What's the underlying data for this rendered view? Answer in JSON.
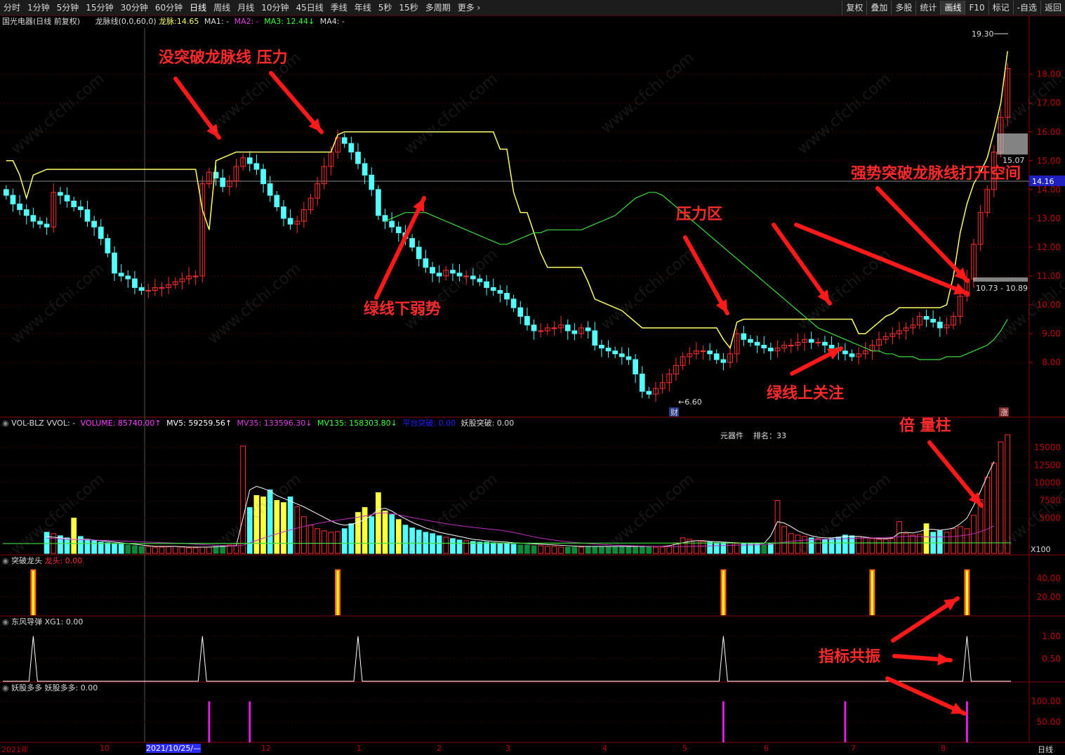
{
  "toolbar": {
    "periods": [
      "分时",
      "1分钟",
      "5分钟",
      "15分钟",
      "30分钟",
      "60分钟",
      "日线",
      "周线",
      "月线",
      "10分钟",
      "45日线",
      "季线",
      "年线",
      "5秒",
      "15秒",
      "多周期",
      "更多"
    ],
    "active_period": "日线",
    "right_buttons": [
      "复权",
      "叠加",
      "多股",
      "统计",
      "画线",
      "F10",
      "标记",
      "-自选",
      "返回"
    ],
    "active_right": "画线"
  },
  "main_panel": {
    "stock_name": "国光电器",
    "mode": "(日线 前复权)",
    "indicator": "龙脉线(0,0,60,0)",
    "longmai_label": "龙脉:",
    "longmai_value": "14.65",
    "ma1": "MA1: -",
    "ma2": "MA2: -",
    "ma3": "MA3: 12.44↓",
    "ma4": "MA4: -",
    "high_label": "19.30",
    "low_label": "6.60",
    "price_tag": "14.16",
    "box1_label": "15.07",
    "box2_label": "10.73 - 10.89",
    "cai_tag": "财",
    "zhang_tag": "涨"
  },
  "volume_panel": {
    "name": "VOL-BLZ",
    "vvol": "VVOL: -",
    "volume": "VOLUME: 85740.00↑",
    "mv5": "MV5: 59259.56↑",
    "mv35": "MV35: 133596.30↓",
    "mv135": "MV135: 158303.80↓",
    "platform": "平台突破: 0.00",
    "yaogu": "妖股突破: 0.00",
    "sector": "元器件",
    "rank": "排名：33",
    "x100": "X100"
  },
  "ind1": {
    "name": "突破龙头",
    "label": "龙头: 0.00"
  },
  "ind2": {
    "name": "东风导弹",
    "label": "XG1: 0.00"
  },
  "ind3": {
    "name": "妖股多多",
    "label": "妖股多多: 0.00"
  },
  "annotations": {
    "a1": "没突破龙脉线 压力",
    "a2": "绿线下弱势",
    "a3": "压力区",
    "a4": "强势突破龙脉线打开空间",
    "a5": "绿线上关注",
    "a6": "倍 量柱",
    "a7": "指标共振"
  },
  "watermark": "www.cfchi.com",
  "bottom_axis": {
    "labels": [
      "2021年",
      "10",
      "2021/10/25/—",
      "12",
      "1",
      "2",
      "3",
      "4",
      "5",
      "6",
      "7",
      "8"
    ],
    "period": "日线"
  },
  "chart_data": [
    {
      "type": "candlestick",
      "title": "国光电器 (日线 前复权)",
      "y_ticks": [
        8.0,
        9.0,
        10.0,
        11.0,
        12.0,
        13.0,
        14.0,
        15.0,
        16.0,
        17.0,
        18.0
      ],
      "ylim": [
        6.2,
        19.6
      ],
      "close": [
        13.8,
        13.5,
        13.3,
        13.1,
        12.9,
        12.8,
        12.7,
        13.9,
        13.8,
        13.6,
        13.4,
        13.3,
        12.9,
        12.7,
        12.3,
        11.8,
        11.1,
        11.0,
        10.9,
        10.6,
        10.5,
        10.5,
        10.6,
        10.6,
        10.7,
        10.8,
        10.9,
        11.0,
        11.0,
        14.2,
        14.6,
        14.4,
        14.1,
        14.3,
        14.8,
        15.1,
        14.9,
        14.7,
        14.2,
        13.8,
        13.4,
        13.0,
        12.8,
        12.9,
        13.3,
        13.7,
        14.2,
        14.8,
        15.3,
        15.8,
        15.6,
        15.3,
        14.9,
        14.5,
        14.0,
        13.1,
        12.9,
        12.7,
        12.5,
        12.3,
        12.0,
        11.6,
        11.3,
        11.1,
        11.0,
        11.2,
        11.1,
        11.0,
        11.0,
        10.9,
        10.8,
        10.6,
        10.5,
        10.4,
        10.2,
        9.9,
        9.6,
        9.3,
        9.1,
        9.1,
        9.2,
        9.2,
        9.3,
        9.1,
        9.0,
        9.2,
        9.1,
        8.6,
        8.5,
        8.4,
        8.3,
        8.2,
        8.1,
        7.6,
        7.0,
        6.9,
        7.1,
        7.3,
        7.6,
        7.9,
        8.2,
        8.3,
        8.4,
        8.4,
        8.3,
        8.1,
        8.0,
        8.3,
        9.0,
        8.8,
        8.7,
        8.6,
        8.5,
        8.4,
        8.5,
        8.6,
        8.6,
        8.7,
        8.8,
        8.7,
        8.7,
        8.6,
        8.5,
        8.4,
        8.3,
        8.2,
        8.3,
        8.4,
        8.6,
        8.8,
        8.9,
        9.0,
        9.1,
        9.2,
        9.3,
        9.6,
        9.5,
        9.4,
        9.2,
        9.3,
        9.6,
        10.3,
        10.9,
        12.1,
        13.2,
        14.0,
        15.3,
        16.5,
        18.2
      ],
      "dragon_line": [
        15.0,
        15.0,
        14.5,
        13.7,
        14.5,
        14.6,
        14.7,
        14.7,
        14.7,
        14.7,
        14.7,
        14.7,
        14.7,
        14.7,
        14.7,
        14.7,
        14.7,
        14.7,
        14.7,
        14.7,
        14.7,
        14.7,
        14.7,
        14.7,
        14.7,
        14.7,
        14.7,
        14.7,
        14.7,
        13.3,
        12.6,
        15.0,
        15.1,
        15.2,
        15.3,
        15.3,
        15.3,
        15.3,
        15.3,
        15.3,
        15.3,
        15.3,
        15.3,
        15.3,
        15.3,
        15.3,
        15.3,
        15.3,
        15.3,
        15.9,
        16.0,
        16.0,
        16.0,
        16.0,
        16.0,
        16.0,
        16.0,
        16.0,
        16.0,
        16.0,
        16.0,
        16.0,
        16.0,
        16.0,
        16.0,
        16.0,
        16.0,
        16.0,
        16.0,
        16.0,
        16.0,
        16.0,
        16.0,
        15.4,
        15.4,
        13.9,
        13.2,
        13.2,
        12.5,
        11.8,
        11.3,
        11.3,
        11.3,
        11.3,
        11.3,
        11.3,
        10.8,
        10.2,
        10.1,
        10.0,
        9.9,
        9.8,
        9.6,
        9.4,
        9.2,
        9.2,
        9.2,
        9.2,
        9.2,
        9.2,
        9.2,
        9.2,
        9.2,
        9.2,
        9.2,
        9.2,
        8.8,
        8.5,
        9.4,
        9.5,
        9.5,
        9.5,
        9.5,
        9.5,
        9.5,
        9.5,
        9.5,
        9.5,
        9.5,
        9.5,
        9.5,
        9.5,
        9.5,
        9.5,
        9.5,
        9.5,
        9.0,
        9.0,
        9.2,
        9.4,
        9.6,
        9.7,
        9.9,
        9.9,
        9.9,
        9.9,
        9.9,
        9.9,
        9.9,
        10.0,
        11.0,
        12.5,
        13.5,
        14.2,
        14.6,
        15.1,
        16.0,
        17.0,
        18.8
      ],
      "ma3_green": [
        12.9,
        13.0,
        13.1,
        13.2,
        13.2,
        13.2,
        13.2,
        13.1,
        13.0,
        12.9,
        12.8,
        12.7,
        12.6,
        12.5,
        12.4,
        12.3,
        12.2,
        12.1,
        12.1,
        12.2,
        12.3,
        12.4,
        12.5,
        12.5,
        12.6,
        12.6,
        12.6,
        12.6,
        12.6,
        12.6,
        12.7,
        12.8,
        12.9,
        13.0,
        13.1,
        13.3,
        13.5,
        13.7,
        13.8,
        13.9,
        13.9,
        13.8,
        13.6,
        13.4,
        13.2,
        13.0,
        12.8,
        12.6,
        12.4,
        12.2,
        12.0,
        11.8,
        11.6,
        11.4,
        11.2,
        11.0,
        10.8,
        10.6,
        10.4,
        10.2,
        10.0,
        9.8,
        9.6,
        9.4,
        9.2,
        9.1,
        9.0,
        8.9,
        8.8,
        8.7,
        8.6,
        8.5,
        8.4,
        8.4,
        8.3,
        8.3,
        8.2,
        8.2,
        8.2,
        8.1,
        8.1,
        8.1,
        8.1,
        8.2,
        8.2,
        8.2,
        8.3,
        8.4,
        8.5,
        8.6,
        8.8,
        9.1,
        9.5
      ],
      "annotations": [
        "没突破龙脉线 压力",
        "绿线下弱势",
        "压力区",
        "强势突破龙脉线打开空间",
        "绿线上关注"
      ],
      "max_label": "19.30",
      "min_label": "6.60"
    },
    {
      "type": "bar",
      "title": "VOL-BLZ",
      "y_ticks": [
        5000,
        7500,
        10000,
        12500,
        15000
      ],
      "ylim": [
        0,
        17500
      ],
      "unit": "X100",
      "volume": [
        3000,
        2800,
        2500,
        2200,
        5000,
        2400,
        2000,
        1800,
        1600,
        1500,
        1400,
        1300,
        1200,
        1100,
        1000,
        1000,
        900,
        900,
        950,
        1000,
        900,
        800,
        800,
        900,
        900,
        1000,
        1100,
        1200,
        1400,
        15200,
        6500,
        8200,
        8000,
        9000,
        7500,
        7200,
        8000,
        6600,
        5200,
        4000,
        3500,
        3200,
        3000,
        3100,
        3500,
        4200,
        5800,
        6500,
        5200,
        8600,
        6000,
        5500,
        4800,
        4000,
        3600,
        3300,
        3000,
        2800,
        2500,
        2300,
        2100,
        1900,
        1800,
        1700,
        1600,
        1600,
        1500,
        1400,
        1400,
        1300,
        1200,
        1200,
        1100,
        1100,
        1000,
        1000,
        900,
        900,
        900,
        900,
        900,
        900,
        900,
        900,
        1000,
        1000,
        1000,
        900,
        900,
        900,
        900,
        900,
        1000,
        1500,
        2200,
        2000,
        1800,
        1700,
        1600,
        1500,
        1500,
        1500,
        1400,
        1400,
        1300,
        1300,
        1200,
        1400,
        7500,
        3800,
        2800,
        2600,
        2400,
        2200,
        2100,
        2000,
        2100,
        2300,
        2600,
        2500,
        2400,
        2200,
        2100,
        2000,
        2000,
        2100,
        4500,
        2800,
        2600,
        2700,
        4200,
        3000,
        3200,
        3000,
        3500,
        3800,
        3500,
        5400,
        7600,
        10800,
        12800,
        15800,
        16800
      ],
      "mv5": [
        2400,
        2300,
        2200,
        2100,
        2000,
        2000,
        2000,
        1900,
        1800,
        1700,
        1600,
        1500,
        1400,
        1300,
        1200,
        1100,
        1000,
        1000,
        1000,
        1000,
        950,
        900,
        900,
        900,
        900,
        950,
        1000,
        1050,
        1100,
        5000,
        9000,
        9500,
        9200,
        8800,
        8200,
        7800,
        7400,
        7000,
        6600,
        6100,
        5600,
        5100,
        4600,
        4200,
        4000,
        4100,
        4400,
        4800,
        5400,
        6200,
        6400,
        6000,
        5400,
        4900,
        4400,
        4000,
        3600,
        3300,
        3000,
        2800,
        2600,
        2400,
        2200,
        2000,
        1900,
        1800,
        1700,
        1650,
        1600,
        1500,
        1450,
        1400,
        1350,
        1300,
        1250,
        1200,
        1150,
        1100,
        1050,
        1000,
        1000,
        1000,
        1000,
        1000,
        1000,
        1000,
        1000,
        1000,
        1000,
        1000,
        1000,
        1000,
        1100,
        1300,
        1500,
        1700,
        1800,
        1800,
        1700,
        1650,
        1600,
        1550,
        1500,
        1450,
        1400,
        1400,
        1400,
        2500,
        4500,
        4300,
        3800,
        3200,
        2800,
        2500,
        2300,
        2200,
        2200,
        2300,
        2400,
        2400,
        2400,
        2300,
        2200,
        2100,
        2100,
        2200,
        2900,
        3000,
        2900,
        3100,
        3400,
        3400,
        3300,
        3400,
        3600,
        4200,
        5000,
        6800,
        8800,
        11000,
        13000
      ],
      "mv35_labels": "MV35: 133596.30↓",
      "mv135_labels": "MV135: 158303.80↓"
    },
    {
      "type": "bar",
      "title": "突破龙头",
      "y_ticks": [
        20.0,
        40.0
      ],
      "ylim": [
        0,
        52
      ],
      "signals": [
        {
          "x": 4,
          "value": 50
        },
        {
          "x": 49,
          "value": 50
        },
        {
          "x": 106,
          "value": 50
        },
        {
          "x": 128,
          "value": 50
        },
        {
          "x": 142,
          "value": 50
        }
      ]
    },
    {
      "type": "line",
      "title": "东风导弹",
      "y_ticks": [
        0.5,
        1.0
      ],
      "ylim": [
        0,
        1.2
      ],
      "signals": [
        {
          "x": 4,
          "value": 1
        },
        {
          "x": 29,
          "value": 1
        },
        {
          "x": 52,
          "value": 1
        },
        {
          "x": 106,
          "value": 1
        },
        {
          "x": 142,
          "value": 1
        }
      ]
    },
    {
      "type": "bar",
      "title": "妖股多多",
      "y_ticks": [
        50.0,
        100.0
      ],
      "ylim": [
        0,
        120
      ],
      "signals": [
        {
          "x": 30,
          "value": 100
        },
        {
          "x": 36,
          "value": 100
        },
        {
          "x": 106,
          "value": 100
        },
        {
          "x": 124,
          "value": 100
        },
        {
          "x": 142,
          "value": 100
        }
      ]
    }
  ]
}
